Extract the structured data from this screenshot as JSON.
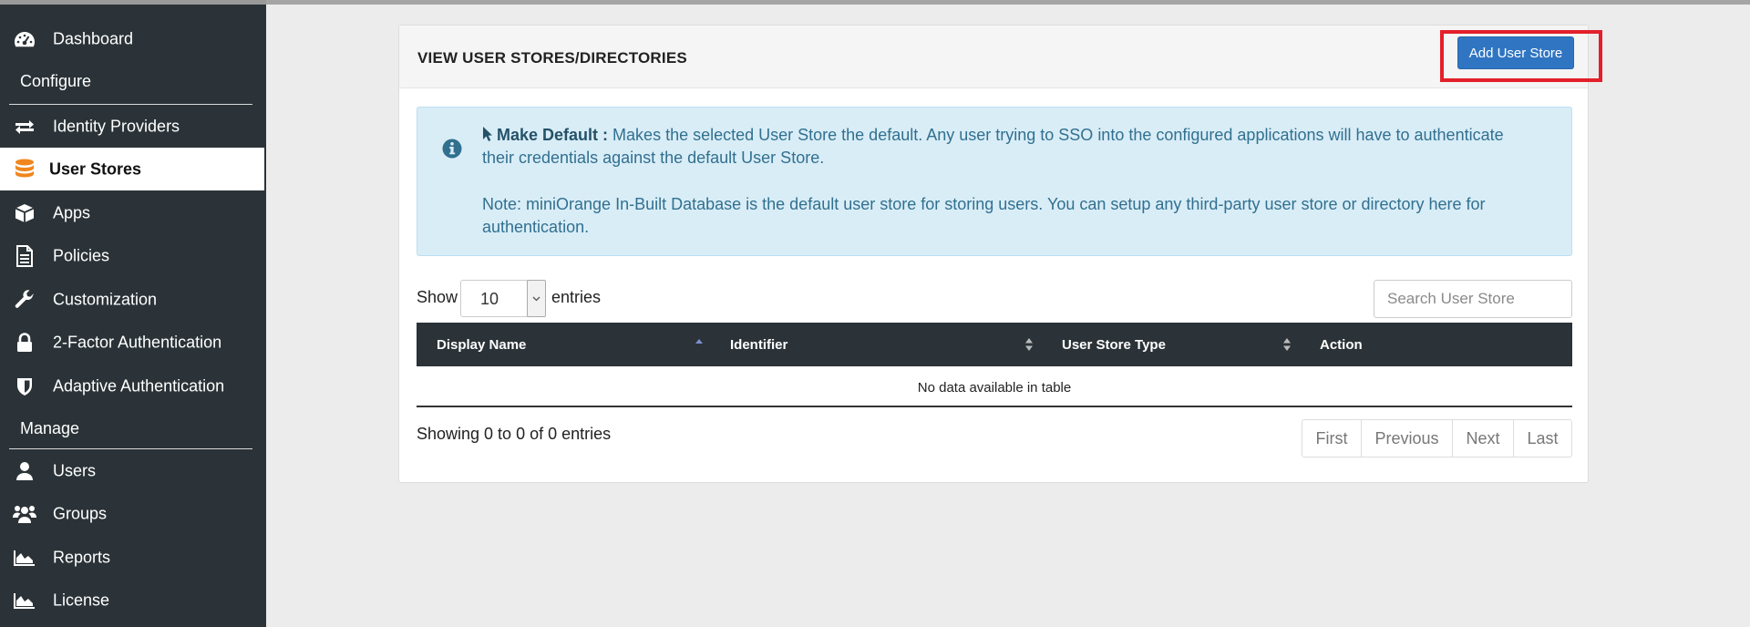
{
  "sidebar": {
    "items": [
      {
        "label": "Dashboard",
        "icon": "dashboard-icon"
      },
      {
        "label": "Identity Providers",
        "icon": "exchange-arrows-icon"
      },
      {
        "label": "User Stores",
        "icon": "database-icon",
        "active": true
      },
      {
        "label": "Apps",
        "icon": "cube-icon"
      },
      {
        "label": "Policies",
        "icon": "document-icon"
      },
      {
        "label": "Customization",
        "icon": "wrench-icon"
      },
      {
        "label": "2-Factor Authentication",
        "icon": "lock-icon"
      },
      {
        "label": "Adaptive Authentication",
        "icon": "shield-icon"
      },
      {
        "label": "Users",
        "icon": "user-icon"
      },
      {
        "label": "Groups",
        "icon": "users-group-icon"
      },
      {
        "label": "Reports",
        "icon": "area-chart-icon"
      },
      {
        "label": "License",
        "icon": "area-chart-icon"
      }
    ],
    "sections": {
      "configure": "Configure",
      "manage": "Manage"
    }
  },
  "card": {
    "title": "VIEW USER STORES/DIRECTORIES",
    "add_button": "Add User Store"
  },
  "info": {
    "bold_label": "Make Default :",
    "p1_text": "Makes the selected User Store the default. Any user trying to SSO into the configured applications will have to authenticate their credentials against the default User Store.",
    "p2_text": "Note: miniOrange In-Built Database is the default user store for storing users. You can setup any third-party user store or directory here for authentication."
  },
  "table_controls": {
    "show_label": "Show",
    "entries_value": "10",
    "entries_label": "entries",
    "search_placeholder": "Search User Store"
  },
  "table": {
    "columns": [
      "Display Name",
      "Identifier",
      "User Store Type",
      "Action"
    ],
    "empty_text": "No data available in table",
    "showing_text": "Showing 0 to 0 of 0 entries"
  },
  "pagination": [
    "First",
    "Previous",
    "Next",
    "Last"
  ],
  "colors": {
    "sidebar_bg": "#2b3338",
    "primary_button": "#2f75c2",
    "info_bg": "#d9edf7",
    "info_text": "#31708f",
    "highlight": "#e3202a"
  }
}
